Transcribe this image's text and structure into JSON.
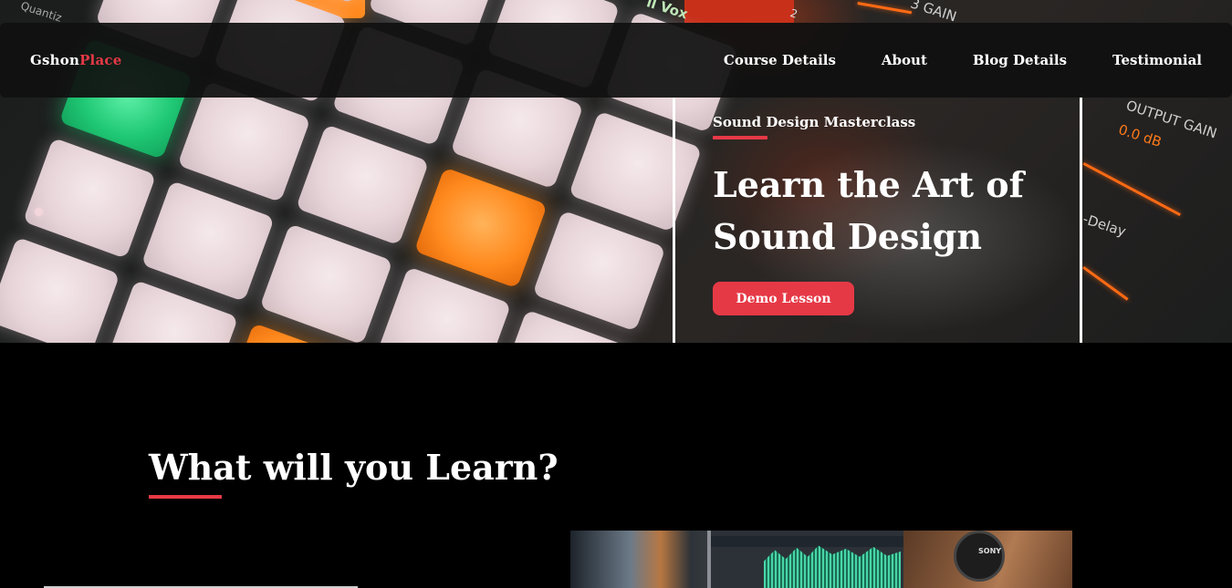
{
  "brand": {
    "first": "Gshon",
    "second": "Place"
  },
  "nav": {
    "items": [
      {
        "label": "Course Details"
      },
      {
        "label": "About"
      },
      {
        "label": "Blog Details"
      },
      {
        "label": "Testimonial"
      }
    ]
  },
  "hero": {
    "eyebrow": "Sound Design Masterclass",
    "title_line1": "Learn the Art of",
    "title_line2": "Sound Design",
    "cta_label": "Demo Lesson",
    "hardware_labels": {
      "top_left": "Quantiz",
      "top_mid": "ll Vox",
      "top_num": "2",
      "top_right": "3 GAIN",
      "output_gain": "OUTPUT GAIN",
      "output_value": "0.0 dB",
      "delay": "-Delay"
    }
  },
  "learn": {
    "title": "What will you Learn?",
    "photo_brand": "SONY"
  },
  "colors": {
    "accent": "#e63946",
    "background": "#000000",
    "navbar": "#101010"
  }
}
